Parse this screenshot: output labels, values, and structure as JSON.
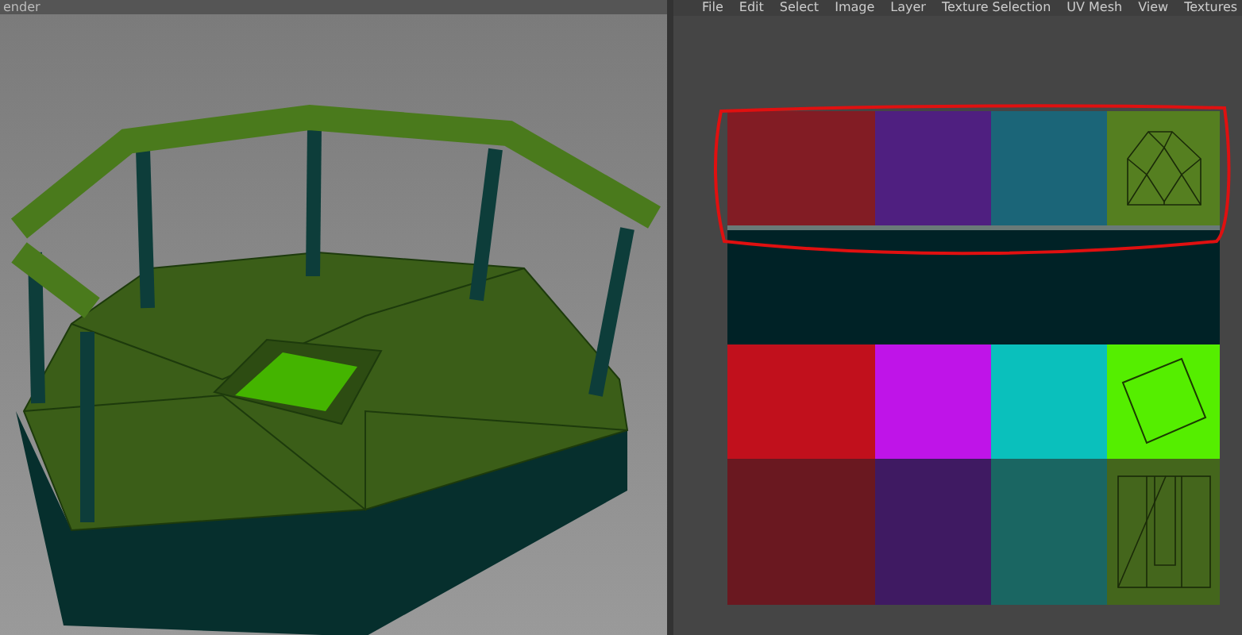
{
  "viewport": {
    "title": "ender"
  },
  "uv_editor": {
    "menu": [
      "File",
      "Edit",
      "Select",
      "Image",
      "Layer",
      "Texture Selection",
      "UV Mesh",
      "View",
      "Textures"
    ],
    "tiles": [
      {
        "kind": "plain",
        "color": "#821c24"
      },
      {
        "kind": "plain",
        "color": "#4f1f80"
      },
      {
        "kind": "plain",
        "color": "#1b6578"
      },
      {
        "kind": "gem",
        "color": "#557f20"
      },
      {
        "kind": "wide",
        "color": "#002226"
      },
      {
        "kind": "plain",
        "color": "#c1101c"
      },
      {
        "kind": "plain",
        "color": "#bf14e8"
      },
      {
        "kind": "plain",
        "color": "#0ac0bc"
      },
      {
        "kind": "square",
        "color": "#55ee00"
      },
      {
        "kind": "plain",
        "color": "#6a1820"
      },
      {
        "kind": "plain",
        "color": "#3f1a62"
      },
      {
        "kind": "plain",
        "color": "#1a6662"
      },
      {
        "kind": "bars",
        "color": "#44661c"
      }
    ]
  }
}
